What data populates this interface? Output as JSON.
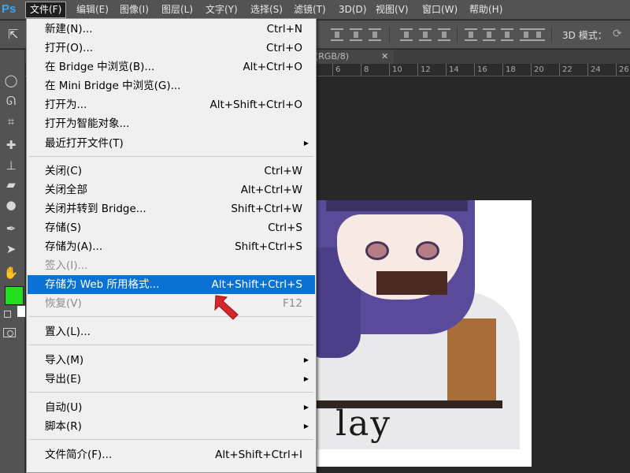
{
  "app": {
    "logo": "Ps"
  },
  "menubar": [
    {
      "label": "文件(F)",
      "active": true
    },
    {
      "label": "编辑(E)"
    },
    {
      "label": "图像(I)"
    },
    {
      "label": "图层(L)"
    },
    {
      "label": "文字(Y)"
    },
    {
      "label": "选择(S)"
    },
    {
      "label": "滤镜(T)"
    },
    {
      "label": "3D(D)"
    },
    {
      "label": "视图(V)"
    },
    {
      "label": "窗口(W)"
    },
    {
      "label": "帮助(H)"
    }
  ],
  "optbar": {
    "mode_label": "3D 模式："
  },
  "document": {
    "tab_title": "(RGB/8)",
    "ruler_numbers": [
      "6",
      "8",
      "10",
      "12",
      "14",
      "16",
      "18",
      "20",
      "22",
      "24",
      "26"
    ]
  },
  "canvas": {
    "image_text": "lay"
  },
  "file_menu": {
    "items": [
      {
        "label": "新建(N)...",
        "shortcut": "Ctrl+N"
      },
      {
        "label": "打开(O)...",
        "shortcut": "Ctrl+O"
      },
      {
        "label": "在 Bridge 中浏览(B)...",
        "shortcut": "Alt+Ctrl+O"
      },
      {
        "label": "在 Mini Bridge 中浏览(G)...",
        "shortcut": ""
      },
      {
        "label": "打开为...",
        "shortcut": "Alt+Shift+Ctrl+O"
      },
      {
        "label": "打开为智能对象...",
        "shortcut": ""
      },
      {
        "label": "最近打开文件(T)",
        "shortcut": "",
        "submenu": true
      },
      {
        "label": "关闭(C)",
        "shortcut": "Ctrl+W"
      },
      {
        "label": "关闭全部",
        "shortcut": "Alt+Ctrl+W"
      },
      {
        "label": "关闭并转到 Bridge...",
        "shortcut": "Shift+Ctrl+W"
      },
      {
        "label": "存储(S)",
        "shortcut": "Ctrl+S"
      },
      {
        "label": "存储为(A)...",
        "shortcut": "Shift+Ctrl+S"
      },
      {
        "label": "签入(I)...",
        "shortcut": "",
        "disabled": true
      },
      {
        "label": "存储为 Web 所用格式...",
        "shortcut": "Alt+Shift+Ctrl+S",
        "highlighted": true
      },
      {
        "label": "恢复(V)",
        "shortcut": "F12",
        "disabled": true
      },
      {
        "label": "置入(L)...",
        "shortcut": ""
      },
      {
        "label": "导入(M)",
        "shortcut": "",
        "submenu": true
      },
      {
        "label": "导出(E)",
        "shortcut": "",
        "submenu": true
      },
      {
        "label": "自动(U)",
        "shortcut": "",
        "submenu": true
      },
      {
        "label": "脚本(R)",
        "shortcut": "",
        "submenu": true
      },
      {
        "label": "文件简介(F)...",
        "shortcut": "Alt+Shift+Ctrl+I"
      }
    ],
    "submenu_glyph": "▶",
    "highlight_color": "#0a72d2",
    "disabled_color": "#8d8d8d"
  },
  "colors": {
    "foreground": "#22e01e",
    "background": "#ffffff",
    "annotation_arrow": "#d9262c"
  },
  "icons": [
    "move-arrow-icon",
    "align-icon",
    "marquee-icon",
    "lasso-icon",
    "crop-icon",
    "healing-brush-icon",
    "stamp-icon",
    "eraser-icon",
    "blur-drop-icon",
    "pen-icon",
    "path-select-icon",
    "hand-icon",
    "quick-mask-icon"
  ]
}
